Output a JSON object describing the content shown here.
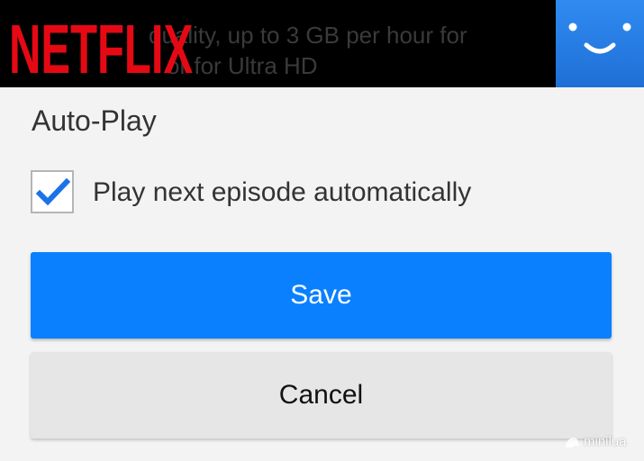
{
  "header": {
    "background_text_line1": "quality, up to 3 GB per hour for",
    "background_text_line2": "or for Ultra HD",
    "logo_text": "NETFLIX",
    "logo_color": "#e50914",
    "avatar_icon": "smiley-face-icon",
    "avatar_color": "#2f8bf0"
  },
  "autoplay": {
    "title": "Auto-Play",
    "checkbox_label": "Play next episode automatically",
    "checked": true,
    "check_color": "#1a73e8"
  },
  "buttons": {
    "save_label": "Save",
    "save_color": "#0a80ff",
    "cancel_label": "Cancel"
  },
  "watermark": {
    "text": "minilua"
  }
}
